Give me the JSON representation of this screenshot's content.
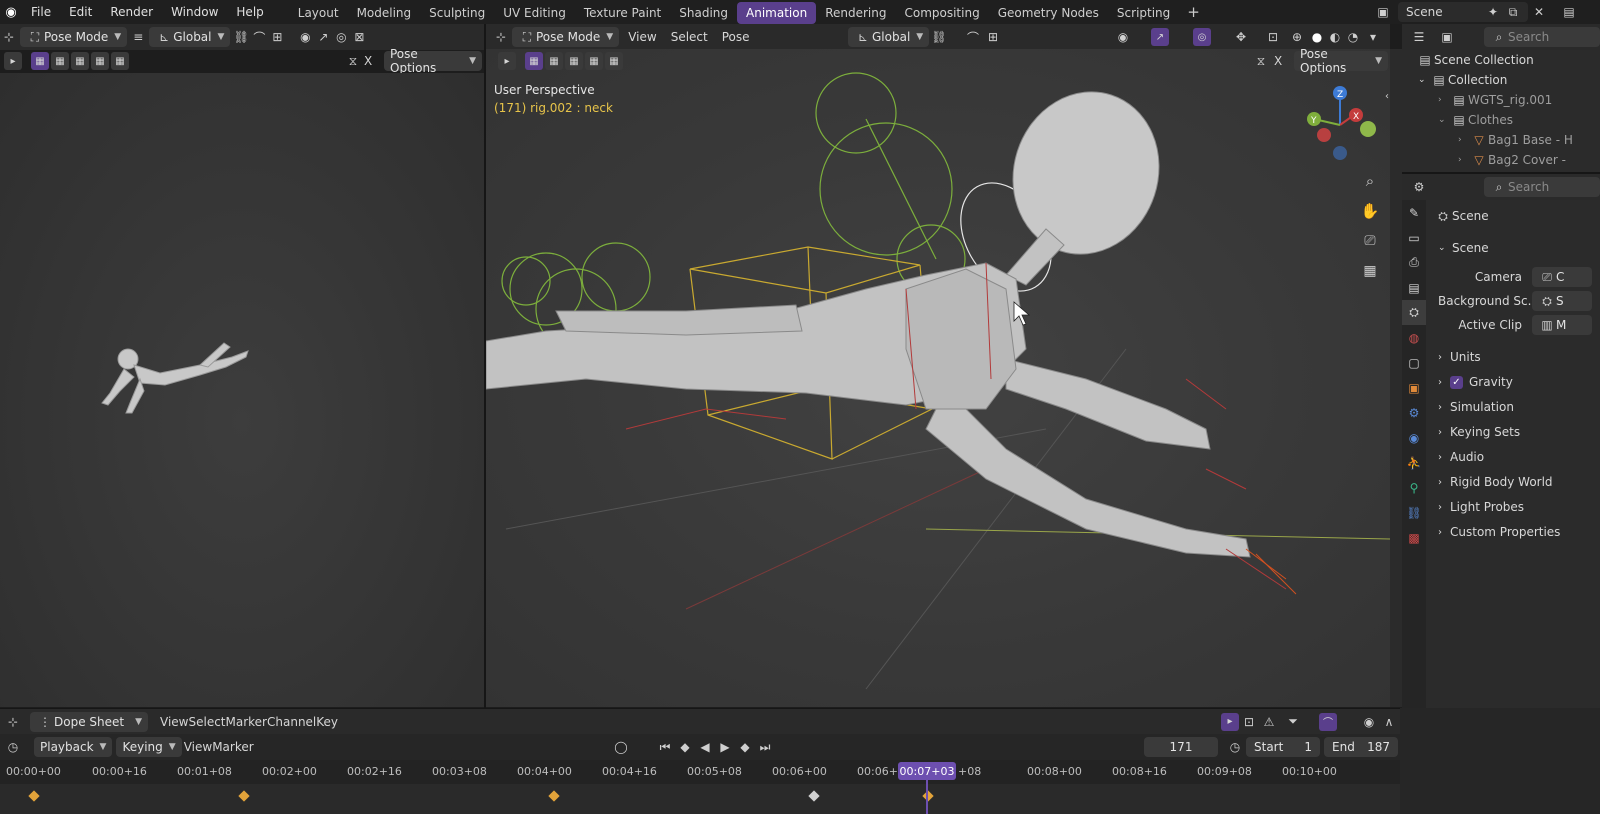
{
  "top_menu": [
    "File",
    "Edit",
    "Render",
    "Window",
    "Help"
  ],
  "workspaces": [
    "Layout",
    "Modeling",
    "Sculpting",
    "UV Editing",
    "Texture Paint",
    "Shading",
    "Animation",
    "Rendering",
    "Compositing",
    "Geometry Nodes",
    "Scripting"
  ],
  "active_workspace": "Animation",
  "scene_name": "Scene",
  "left_header": {
    "mode": "Pose Mode",
    "orientation": "Global",
    "pose_options": "Pose Options",
    "x_label": "X"
  },
  "main_header": {
    "mode": "Pose Mode",
    "view": "View",
    "select": "Select",
    "pose": "Pose",
    "orientation": "Global",
    "pose_options": "Pose Options",
    "x_label": "X"
  },
  "viewport": {
    "title": "User Perspective",
    "active_object": "(171) rig.002 : neck"
  },
  "gizmo": {
    "x": "X",
    "y": "Y",
    "z": "Z"
  },
  "outliner": {
    "search_placeholder": "Search",
    "items": [
      {
        "label": "Scene Collection"
      },
      {
        "label": "Collection"
      },
      {
        "label": "WGTS_rig.001"
      },
      {
        "label": "Clothes"
      },
      {
        "label": "Bag1 Base - H"
      },
      {
        "label": "Bag2 Cover - "
      }
    ]
  },
  "properties": {
    "search_placeholder": "Search",
    "breadcrumb": "Scene",
    "panel_title": "Scene",
    "fields": [
      {
        "label": "Camera",
        "value": "C"
      },
      {
        "label": "Background Sc...",
        "value": "S"
      },
      {
        "label": "Active Clip",
        "value": "M"
      }
    ],
    "sections": [
      "Units",
      "Gravity",
      "Simulation",
      "Keying Sets",
      "Audio",
      "Rigid Body World",
      "Light Probes",
      "Custom Properties"
    ],
    "gravity_checked": true
  },
  "dope_sheet": {
    "mode": "Dope Sheet",
    "menu": [
      "View",
      "Select",
      "Marker",
      "Channel",
      "Key"
    ]
  },
  "timeline": {
    "playback": "Playback",
    "keying": "Keying",
    "view": "View",
    "marker": "Marker",
    "current_frame": "171",
    "start_label": "Start",
    "start": "1",
    "end_label": "End",
    "end": "187",
    "playhead_time": "00:07+03",
    "ticks": [
      "00:00+00",
      "00:00+16",
      "00:01+08",
      "00:02+00",
      "00:02+16",
      "00:03+08",
      "00:04+00",
      "00:04+16",
      "00:05+08",
      "00:06+00",
      "00:06+16",
      "+08",
      "00:08+00",
      "00:08+16",
      "00:09+08",
      "00:10+00"
    ]
  },
  "colors": {
    "accent": "#5a3f8c",
    "playhead": "#6d4fb0",
    "active_text": "#e7c44a",
    "keyframe": "#e2a33a"
  }
}
